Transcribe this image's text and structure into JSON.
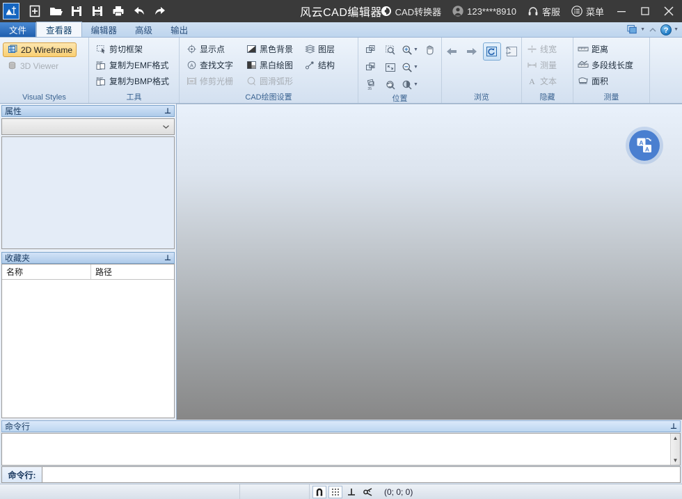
{
  "titlebar": {
    "app_title": "风云CAD编辑器",
    "logo_name": "app-logo",
    "quick_access": [
      {
        "name": "new-file-button",
        "icon": "plus-square-icon"
      },
      {
        "name": "open-file-button",
        "icon": "folder-icon"
      },
      {
        "name": "save-button",
        "icon": "floppy-icon"
      },
      {
        "name": "save-as-pdf-button",
        "icon": "floppy-pdf-icon"
      },
      {
        "name": "print-button",
        "icon": "printer-icon"
      },
      {
        "name": "undo-button",
        "icon": "undo-arrow-icon"
      },
      {
        "name": "redo-button",
        "icon": "redo-arrow-icon"
      }
    ],
    "converter_label": "CAD转换器",
    "account_label": "123****8910",
    "support_label": "客服",
    "menu_label": "菜单",
    "minimize": "—",
    "maximize": "□",
    "close": "✕"
  },
  "tabs": [
    {
      "label": "文件",
      "state": "file"
    },
    {
      "label": "查看器",
      "state": "active"
    },
    {
      "label": "编辑器",
      "state": "normal"
    },
    {
      "label": "高级",
      "state": "normal"
    },
    {
      "label": "输出",
      "state": "normal"
    }
  ],
  "tab_right": {
    "window_options": "window-options-icon",
    "collapse_ribbon": "collapse-chevron-icon",
    "help": "?"
  },
  "ribbon": {
    "groups": [
      {
        "title": "Visual Styles",
        "items": [
          {
            "label": "2D Wireframe",
            "icon": "wireframe-cube-icon",
            "state": "selected"
          },
          {
            "label": "3D Viewer",
            "icon": "cylinder-icon",
            "state": "disabled"
          }
        ]
      },
      {
        "title": "工具",
        "items": [
          {
            "label": "剪切框架",
            "icon": "crop-frame-icon",
            "state": "normal"
          },
          {
            "label": "复制为EMF格式",
            "icon": "copy-emf-icon",
            "state": "normal"
          },
          {
            "label": "复制为BMP格式",
            "icon": "copy-bmp-icon",
            "state": "normal"
          }
        ]
      },
      {
        "title": "CAD绘图设置",
        "col1": [
          {
            "label": "显示点",
            "icon": "show-points-icon",
            "state": "normal"
          },
          {
            "label": "查找文字",
            "icon": "find-text-icon",
            "state": "normal"
          },
          {
            "label": "修剪光栅",
            "icon": "trim-raster-icon",
            "state": "disabled"
          }
        ],
        "col2": [
          {
            "label": "黑色背景",
            "icon": "black-background-icon",
            "state": "normal"
          },
          {
            "label": "黑白绘图",
            "icon": "monochrome-icon",
            "state": "normal"
          },
          {
            "label": "圆滑弧形",
            "icon": "smooth-arc-icon",
            "state": "disabled"
          }
        ],
        "col3": [
          {
            "label": "图层",
            "icon": "layers-icon",
            "state": "normal"
          },
          {
            "label": "结构",
            "icon": "structure-icon",
            "state": "normal"
          }
        ]
      },
      {
        "title": "位置",
        "grid": [
          {
            "name": "zoom-window-button",
            "icon": "zoom-window-icon",
            "caret": false
          },
          {
            "name": "zoom-select-button",
            "icon": "zoom-marquee-icon",
            "caret": false
          },
          {
            "name": "zoom-in-button",
            "icon": "zoom-in-icon",
            "caret": true
          },
          {
            "name": "pan-button",
            "icon": "hand-pan-icon",
            "caret": false
          },
          {
            "name": "zoom-extents-button",
            "icon": "zoom-extents-icon",
            "caret": false
          },
          {
            "name": "fit-screen-button",
            "icon": "fit-screen-icon",
            "caret": false
          },
          {
            "name": "zoom-out-button",
            "icon": "zoom-out-icon",
            "caret": true
          },
          {
            "name": "spacer-cell",
            "icon": "",
            "caret": false
          },
          {
            "name": "rotate-35-button",
            "icon": "rotate-35-icon",
            "caret": false
          },
          {
            "name": "zoom-previous-button",
            "icon": "zoom-previous-icon",
            "caret": false
          },
          {
            "name": "zoom-realtime-button",
            "icon": "zoom-realtime-icon",
            "caret": true
          },
          {
            "name": "spacer-cell-2",
            "icon": "",
            "caret": false
          }
        ]
      },
      {
        "title": "浏览",
        "nav": [
          {
            "name": "back-button",
            "icon": "arrow-left-icon",
            "state": "normal"
          },
          {
            "name": "forward-button",
            "icon": "arrow-right-icon",
            "state": "normal"
          },
          {
            "name": "refresh-view-button",
            "icon": "refresh-view-icon",
            "state": "active"
          },
          {
            "name": "restore-view-button",
            "icon": "restore-view-icon",
            "state": "normal"
          }
        ]
      },
      {
        "title": "隐藏",
        "items": [
          {
            "label": "线宽",
            "icon": "lineweight-icon",
            "state": "disabled"
          },
          {
            "label": "测量",
            "icon": "dimension-icon",
            "state": "disabled"
          },
          {
            "label": "文本",
            "icon": "text-a-icon",
            "state": "disabled"
          }
        ]
      },
      {
        "title": "测量",
        "items": [
          {
            "label": "距离",
            "icon": "distance-icon",
            "state": "normal"
          },
          {
            "label": "多段线长度",
            "icon": "polyline-length-icon",
            "state": "normal"
          },
          {
            "label": "面积",
            "icon": "area-icon",
            "state": "normal"
          }
        ]
      }
    ]
  },
  "left_panel": {
    "properties": {
      "title": "属性",
      "pin_icon": "pin-icon",
      "combo_value": "",
      "combo_caret": "chevron-down-icon"
    },
    "favorites": {
      "title": "收藏夹",
      "pin_icon": "pin-icon",
      "columns": [
        "名称",
        "路径"
      ],
      "rows": []
    }
  },
  "canvas": {
    "translate_button": "translate-icon"
  },
  "command": {
    "panel_title": "命令行",
    "history": "",
    "prompt_label": "命令行:",
    "input_value": "",
    "scroll_up": "▲",
    "scroll_down": "▼"
  },
  "statusbar": {
    "toggles": [
      {
        "name": "osnap-toggle",
        "icon": "magnet-icon",
        "state": "on"
      },
      {
        "name": "grid-toggle",
        "icon": "grid-dots-icon",
        "state": "on"
      },
      {
        "name": "ortho-toggle",
        "icon": "perpendicular-icon",
        "state": "off"
      },
      {
        "name": "polar-toggle",
        "icon": "polar-track-icon",
        "state": "off"
      }
    ],
    "coordinates": "(0; 0; 0)"
  },
  "colors": {
    "titlebar_bg": "#3a3a3a",
    "accent_blue": "#1f5fae",
    "ribbon_bg": "#dfe9f5",
    "panel_title_blue": "#aecbea",
    "canvas_top": "#e9f1fb",
    "canvas_bottom": "#878787",
    "selected_gold": "#f9cf72",
    "fab_blue": "#4a7fd0"
  }
}
